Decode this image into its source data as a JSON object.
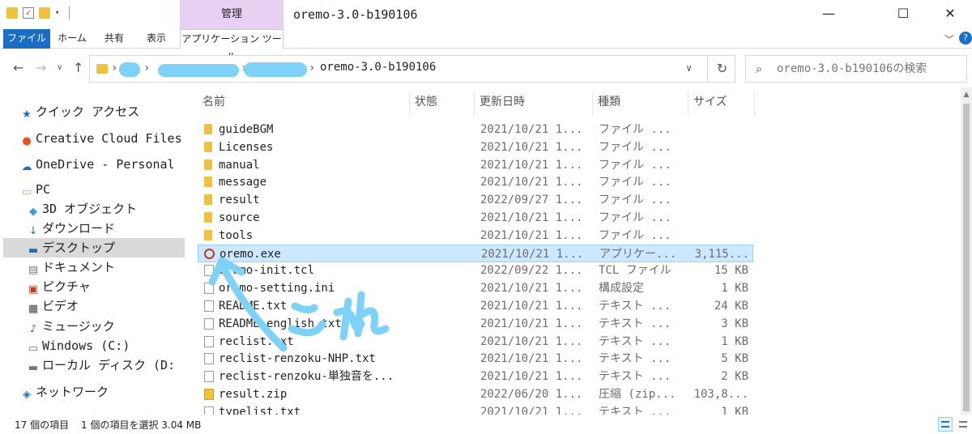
{
  "titlebar": {
    "manage_tab": "管理",
    "window_title": "oremo-3.0-b190106",
    "minimize": "—",
    "maximize": "☐",
    "close": "✕"
  },
  "ribbon": {
    "tabs": [
      "ファイル",
      "ホーム",
      "共有",
      "表示",
      "アプリケーション ツール"
    ]
  },
  "address": {
    "current": "oremo-3.0-b190106",
    "search_placeholder": "oremo-3.0-b190106の検索"
  },
  "navpane": {
    "items": [
      {
        "label": "クイック アクセス",
        "icon": "star-icon"
      },
      {
        "label": "Creative Cloud Files",
        "icon": "creative-cloud-icon"
      },
      {
        "label": "OneDrive - Personal",
        "icon": "onedrive-icon"
      },
      {
        "label": "PC",
        "icon": "pc-icon"
      },
      {
        "label": "3D オブジェクト",
        "icon": "3d-objects-icon"
      },
      {
        "label": "ダウンロード",
        "icon": "download-icon"
      },
      {
        "label": "デスクトップ",
        "icon": "desktop-icon"
      },
      {
        "label": "ドキュメント",
        "icon": "documents-icon"
      },
      {
        "label": "ピクチャ",
        "icon": "pictures-icon"
      },
      {
        "label": "ビデオ",
        "icon": "video-icon"
      },
      {
        "label": "ミュージック",
        "icon": "music-icon"
      },
      {
        "label": "Windows (C:)",
        "icon": "drive-c-icon"
      },
      {
        "label": "ローカル ディスク (D:",
        "icon": "drive-d-icon"
      },
      {
        "label": "ネットワーク",
        "icon": "network-icon"
      }
    ]
  },
  "filelist": {
    "columns": [
      "名前",
      "状態",
      "更新日時",
      "種類",
      "サイズ"
    ],
    "rows": [
      {
        "name": "guideBGM",
        "date": "2021/10/21 1...",
        "type": "ファイル ...",
        "size": "",
        "kind": "folder"
      },
      {
        "name": "Licenses",
        "date": "2021/10/21 1...",
        "type": "ファイル ...",
        "size": "",
        "kind": "folder"
      },
      {
        "name": "manual",
        "date": "2021/10/21 1...",
        "type": "ファイル ...",
        "size": "",
        "kind": "folder"
      },
      {
        "name": "message",
        "date": "2021/10/21 1...",
        "type": "ファイル ...",
        "size": "",
        "kind": "folder"
      },
      {
        "name": "result",
        "date": "2022/09/27 1...",
        "type": "ファイル ...",
        "size": "",
        "kind": "folder"
      },
      {
        "name": "source",
        "date": "2021/10/21 1...",
        "type": "ファイル ...",
        "size": "",
        "kind": "folder"
      },
      {
        "name": "tools",
        "date": "2021/10/21 1...",
        "type": "ファイル ...",
        "size": "",
        "kind": "folder"
      },
      {
        "name": "oremo.exe",
        "date": "2021/10/21 1...",
        "type": "アプリケー...",
        "size": "3,115...",
        "kind": "exe"
      },
      {
        "name": "oremo-init.tcl",
        "date": "2022/09/22 1...",
        "type": "TCL ファイル",
        "size": "15 KB",
        "kind": "file"
      },
      {
        "name": "oremo-setting.ini",
        "date": "2021/10/21 1...",
        "type": "構成設定",
        "size": "1 KB",
        "kind": "ini"
      },
      {
        "name": "README.txt",
        "date": "2021/10/21 1...",
        "type": "テキスト ...",
        "size": "24 KB",
        "kind": "file"
      },
      {
        "name": "README-english.txt",
        "date": "2021/10/21 1...",
        "type": "テキスト ...",
        "size": "3 KB",
        "kind": "file"
      },
      {
        "name": "reclist.txt",
        "date": "2021/10/21 1...",
        "type": "テキスト ...",
        "size": "1 KB",
        "kind": "file"
      },
      {
        "name": "reclist-renzoku-NHP.txt",
        "date": "2021/10/21 1...",
        "type": "テキスト ...",
        "size": "5 KB",
        "kind": "file"
      },
      {
        "name": "reclist-renzoku-単独音を...",
        "date": "2021/10/21 1...",
        "type": "テキスト ...",
        "size": "2 KB",
        "kind": "file"
      },
      {
        "name": "result.zip",
        "date": "2022/06/20 1...",
        "type": "圧縮 (zip...",
        "size": "103,8...",
        "kind": "zip"
      },
      {
        "name": "typelist.txt",
        "date": "2021/10/21 1...",
        "type": "テキスト ...",
        "size": "1 KB",
        "kind": "file"
      }
    ],
    "selected_index": 7
  },
  "statusbar": {
    "count": "17 個の項目",
    "selection": "1 個の項目を選択 3.04 MB"
  },
  "colors": {
    "file_tab": "#1a6fc4",
    "manage_tab": "#e8d0f2",
    "selection": "#cce8ff",
    "annotation": "#7ed1f7"
  }
}
